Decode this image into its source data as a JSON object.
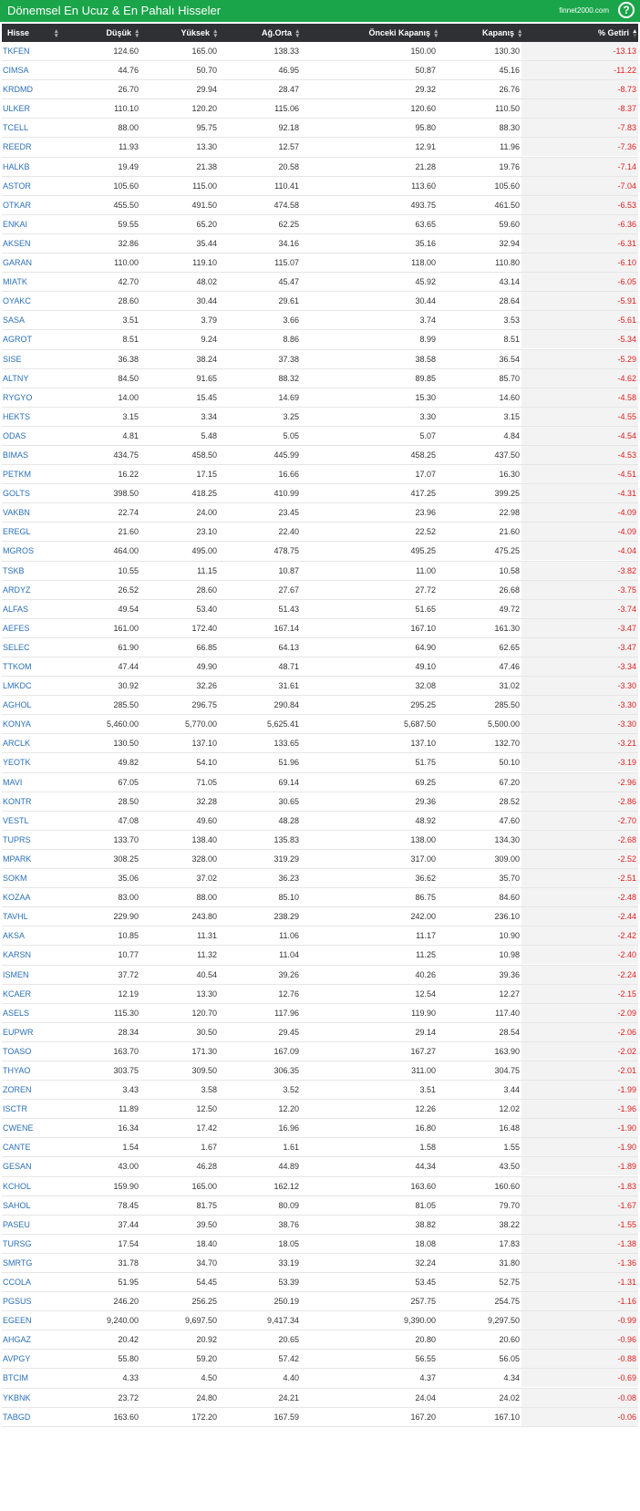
{
  "header": {
    "title": "Dönemsel En Ucuz & En Pahalı Hisseler",
    "brand": "finnet2000.com",
    "help_icon": "?"
  },
  "columns": {
    "symbol": "Hisse",
    "low": "Düşük",
    "high": "Yüksek",
    "avg": "Ağ.Orta",
    "prev_close": "Önceki Kapanış",
    "close": "Kapanış",
    "return": "% Getiri"
  },
  "colors": {
    "header_bg": "#1aa54a",
    "table_head_bg": "#2f3033",
    "symbol_link": "#2b70b8",
    "negative": "#e02020"
  },
  "rows": [
    [
      "TKFEN",
      "124.60",
      "165.00",
      "138.33",
      "150.00",
      "130.30",
      "-13.13"
    ],
    [
      "CIMSA",
      "44.76",
      "50.70",
      "46.95",
      "50.87",
      "45.16",
      "-11.22"
    ],
    [
      "KRDMD",
      "26.70",
      "29.94",
      "28.47",
      "29.32",
      "26.76",
      "-8.73"
    ],
    [
      "ULKER",
      "110.10",
      "120.20",
      "115.06",
      "120.60",
      "110.50",
      "-8.37"
    ],
    [
      "TCELL",
      "88.00",
      "95.75",
      "92.18",
      "95.80",
      "88.30",
      "-7.83"
    ],
    [
      "REEDR",
      "11.93",
      "13.30",
      "12.57",
      "12.91",
      "11.96",
      "-7.36"
    ],
    [
      "HALKB",
      "19.49",
      "21.38",
      "20.58",
      "21.28",
      "19.76",
      "-7.14"
    ],
    [
      "ASTOR",
      "105.60",
      "115.00",
      "110.41",
      "113.60",
      "105.60",
      "-7.04"
    ],
    [
      "OTKAR",
      "455.50",
      "491.50",
      "474.58",
      "493.75",
      "461.50",
      "-6.53"
    ],
    [
      "ENKAI",
      "59.55",
      "65.20",
      "62.25",
      "63.65",
      "59.60",
      "-6.36"
    ],
    [
      "AKSEN",
      "32.86",
      "35.44",
      "34.16",
      "35.16",
      "32.94",
      "-6.31"
    ],
    [
      "GARAN",
      "110.00",
      "119.10",
      "115.07",
      "118.00",
      "110.80",
      "-6.10"
    ],
    [
      "MIATK",
      "42.70",
      "48.02",
      "45.47",
      "45.92",
      "43.14",
      "-6.05"
    ],
    [
      "OYAKC",
      "28.60",
      "30.44",
      "29.61",
      "30.44",
      "28.64",
      "-5.91"
    ],
    [
      "SASA",
      "3.51",
      "3.79",
      "3.66",
      "3.74",
      "3.53",
      "-5.61"
    ],
    [
      "AGROT",
      "8.51",
      "9.24",
      "8.86",
      "8.99",
      "8.51",
      "-5.34"
    ],
    [
      "SISE",
      "36.38",
      "38.24",
      "37.38",
      "38.58",
      "36.54",
      "-5.29"
    ],
    [
      "ALTNY",
      "84.50",
      "91.65",
      "88.32",
      "89.85",
      "85.70",
      "-4.62"
    ],
    [
      "RYGYO",
      "14.00",
      "15.45",
      "14.69",
      "15.30",
      "14.60",
      "-4.58"
    ],
    [
      "HEKTS",
      "3.15",
      "3.34",
      "3.25",
      "3.30",
      "3.15",
      "-4.55"
    ],
    [
      "ODAS",
      "4.81",
      "5.48",
      "5.05",
      "5.07",
      "4.84",
      "-4.54"
    ],
    [
      "BIMAS",
      "434.75",
      "458.50",
      "445.99",
      "458.25",
      "437.50",
      "-4.53"
    ],
    [
      "PETKM",
      "16.22",
      "17.15",
      "16.66",
      "17.07",
      "16.30",
      "-4.51"
    ],
    [
      "GOLTS",
      "398.50",
      "418.25",
      "410.99",
      "417.25",
      "399.25",
      "-4.31"
    ],
    [
      "VAKBN",
      "22.74",
      "24.00",
      "23.45",
      "23.96",
      "22.98",
      "-4.09"
    ],
    [
      "EREGL",
      "21.60",
      "23.10",
      "22.40",
      "22.52",
      "21.60",
      "-4.09"
    ],
    [
      "MGROS",
      "464.00",
      "495.00",
      "478.75",
      "495.25",
      "475.25",
      "-4.04"
    ],
    [
      "TSKB",
      "10.55",
      "11.15",
      "10.87",
      "11.00",
      "10.58",
      "-3.82"
    ],
    [
      "ARDYZ",
      "26.52",
      "28.60",
      "27.67",
      "27.72",
      "26.68",
      "-3.75"
    ],
    [
      "ALFAS",
      "49.54",
      "53.40",
      "51.43",
      "51.65",
      "49.72",
      "-3.74"
    ],
    [
      "AEFES",
      "161.00",
      "172.40",
      "167.14",
      "167.10",
      "161.30",
      "-3.47"
    ],
    [
      "SELEC",
      "61.90",
      "66.85",
      "64.13",
      "64.90",
      "62.65",
      "-3.47"
    ],
    [
      "TTKOM",
      "47.44",
      "49.90",
      "48.71",
      "49.10",
      "47.46",
      "-3.34"
    ],
    [
      "LMKDC",
      "30.92",
      "32.26",
      "31.61",
      "32.08",
      "31.02",
      "-3.30"
    ],
    [
      "AGHOL",
      "285.50",
      "296.75",
      "290.84",
      "295.25",
      "285.50",
      "-3.30"
    ],
    [
      "KONYA",
      "5,460.00",
      "5,770.00",
      "5,625.41",
      "5,687.50",
      "5,500.00",
      "-3.30"
    ],
    [
      "ARCLK",
      "130.50",
      "137.10",
      "133.65",
      "137.10",
      "132.70",
      "-3.21"
    ],
    [
      "YEOTK",
      "49.82",
      "54.10",
      "51.96",
      "51.75",
      "50.10",
      "-3.19"
    ],
    [
      "MAVI",
      "67.05",
      "71.05",
      "69.14",
      "69.25",
      "67.20",
      "-2.96"
    ],
    [
      "KONTR",
      "28.50",
      "32.28",
      "30.65",
      "29.36",
      "28.52",
      "-2.86"
    ],
    [
      "VESTL",
      "47.08",
      "49.60",
      "48.28",
      "48.92",
      "47.60",
      "-2.70"
    ],
    [
      "TUPRS",
      "133.70",
      "138.40",
      "135.83",
      "138.00",
      "134.30",
      "-2.68"
    ],
    [
      "MPARK",
      "308.25",
      "328.00",
      "319.29",
      "317.00",
      "309.00",
      "-2.52"
    ],
    [
      "SOKM",
      "35.06",
      "37.02",
      "36.23",
      "36.62",
      "35.70",
      "-2.51"
    ],
    [
      "KOZAA",
      "83.00",
      "88.00",
      "85.10",
      "86.75",
      "84.60",
      "-2.48"
    ],
    [
      "TAVHL",
      "229.90",
      "243.80",
      "238.29",
      "242.00",
      "236.10",
      "-2.44"
    ],
    [
      "AKSA",
      "10.85",
      "11.31",
      "11.06",
      "11.17",
      "10.90",
      "-2.42"
    ],
    [
      "KARSN",
      "10.77",
      "11.32",
      "11.04",
      "11.25",
      "10.98",
      "-2.40"
    ],
    [
      "ISMEN",
      "37.72",
      "40.54",
      "39.26",
      "40.26",
      "39.36",
      "-2.24"
    ],
    [
      "KCAER",
      "12.19",
      "13.30",
      "12.76",
      "12.54",
      "12.27",
      "-2.15"
    ],
    [
      "ASELS",
      "115.30",
      "120.70",
      "117.96",
      "119.90",
      "117.40",
      "-2.09"
    ],
    [
      "EUPWR",
      "28.34",
      "30.50",
      "29.45",
      "29.14",
      "28.54",
      "-2.06"
    ],
    [
      "TOASO",
      "163.70",
      "171.30",
      "167.09",
      "167.27",
      "163.90",
      "-2.02"
    ],
    [
      "THYAO",
      "303.75",
      "309.50",
      "306.35",
      "311.00",
      "304.75",
      "-2.01"
    ],
    [
      "ZOREN",
      "3.43",
      "3.58",
      "3.52",
      "3.51",
      "3.44",
      "-1.99"
    ],
    [
      "ISCTR",
      "11.89",
      "12.50",
      "12.20",
      "12.26",
      "12.02",
      "-1.96"
    ],
    [
      "CWENE",
      "16.34",
      "17.42",
      "16.96",
      "16.80",
      "16.48",
      "-1.90"
    ],
    [
      "CANTE",
      "1.54",
      "1.67",
      "1.61",
      "1.58",
      "1.55",
      "-1.90"
    ],
    [
      "GESAN",
      "43.00",
      "46.28",
      "44.89",
      "44.34",
      "43.50",
      "-1.89"
    ],
    [
      "KCHOL",
      "159.90",
      "165.00",
      "162.12",
      "163.60",
      "160.60",
      "-1.83"
    ],
    [
      "SAHOL",
      "78.45",
      "81.75",
      "80.09",
      "81.05",
      "79.70",
      "-1.67"
    ],
    [
      "PASEU",
      "37.44",
      "39.50",
      "38.76",
      "38.82",
      "38.22",
      "-1.55"
    ],
    [
      "TURSG",
      "17.54",
      "18.40",
      "18.05",
      "18.08",
      "17.83",
      "-1.38"
    ],
    [
      "SMRTG",
      "31.78",
      "34.70",
      "33.19",
      "32.24",
      "31.80",
      "-1.36"
    ],
    [
      "CCOLA",
      "51.95",
      "54.45",
      "53.39",
      "53.45",
      "52.75",
      "-1.31"
    ],
    [
      "PGSUS",
      "246.20",
      "256.25",
      "250.19",
      "257.75",
      "254.75",
      "-1.16"
    ],
    [
      "EGEEN",
      "9,240.00",
      "9,697.50",
      "9,417.34",
      "9,390.00",
      "9,297.50",
      "-0.99"
    ],
    [
      "AHGAZ",
      "20.42",
      "20.92",
      "20.65",
      "20.80",
      "20.60",
      "-0.96"
    ],
    [
      "AVPGY",
      "55.80",
      "59.20",
      "57.42",
      "56.55",
      "56.05",
      "-0.88"
    ],
    [
      "BTCIM",
      "4.33",
      "4.50",
      "4.40",
      "4.37",
      "4.34",
      "-0.69"
    ],
    [
      "YKBNK",
      "23.72",
      "24.80",
      "24.21",
      "24.04",
      "24.02",
      "-0.08"
    ],
    [
      "TABGD",
      "163.60",
      "172.20",
      "167.59",
      "167.20",
      "167.10",
      "-0.06"
    ]
  ]
}
